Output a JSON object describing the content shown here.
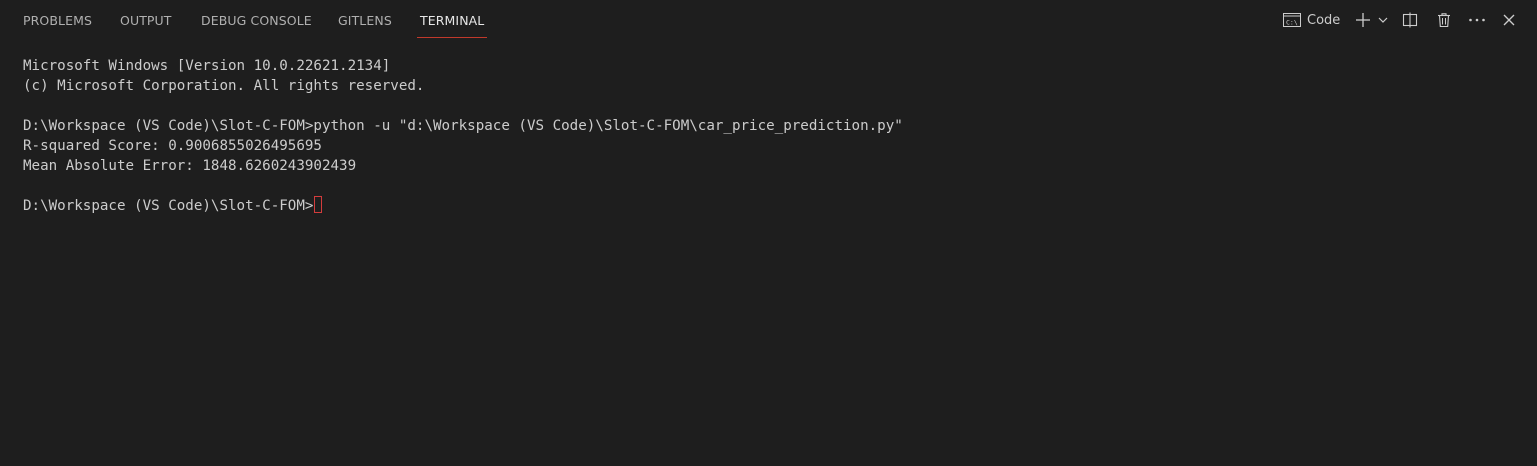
{
  "tabs": [
    {
      "label": "PROBLEMS"
    },
    {
      "label": "OUTPUT"
    },
    {
      "label": "DEBUG CONSOLE"
    },
    {
      "label": "GITLENS"
    },
    {
      "label": "TERMINAL",
      "active": true
    }
  ],
  "toolbar": {
    "terminal_name": "Code",
    "icons": [
      "terminal-shell-icon",
      "plus-icon",
      "chevron-down-icon",
      "split-icon",
      "trash-icon",
      "more-icon",
      "close-icon"
    ]
  },
  "terminal": {
    "lines": [
      "Microsoft Windows [Version 10.0.22621.2134]",
      "(c) Microsoft Corporation. All rights reserved.",
      "",
      "D:\\Workspace (VS Code)\\Slot-C-FOM>python -u \"d:\\Workspace (VS Code)\\Slot-C-FOM\\car_price_prediction.py\"",
      "R-squared Score: 0.9006855026495695",
      "Mean Absolute Error: 1848.6260243902439",
      ""
    ],
    "prompt": "D:\\Workspace (VS Code)\\Slot-C-FOM>"
  },
  "colors": {
    "background": "#1e1e1e",
    "text": "#cccccc",
    "active_tab_underline": "#c0392b",
    "cursor": "#d33c3c"
  }
}
